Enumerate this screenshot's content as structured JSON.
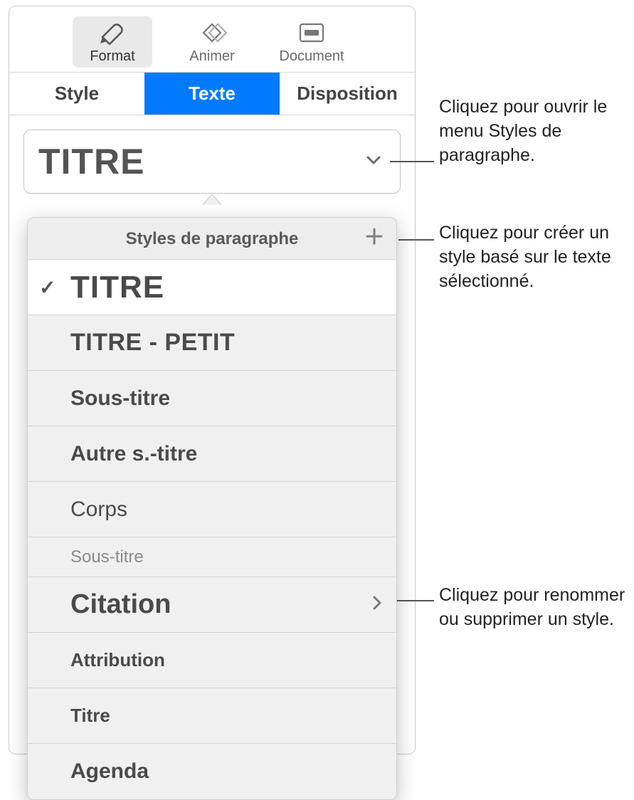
{
  "toolbar": {
    "items": [
      {
        "label": "Format",
        "active": true
      },
      {
        "label": "Animer",
        "active": false
      },
      {
        "label": "Document",
        "active": false
      }
    ]
  },
  "subtabs": {
    "items": [
      {
        "label": "Style",
        "active": false
      },
      {
        "label": "Texte",
        "active": true
      },
      {
        "label": "Disposition",
        "active": false
      }
    ]
  },
  "style_button": {
    "current": "TITRE"
  },
  "popover": {
    "title": "Styles de paragraphe",
    "items": [
      {
        "label": "TITRE",
        "class": "s-titre",
        "checked": true,
        "arrow": false
      },
      {
        "label": "TITRE - PETIT",
        "class": "s-titrep",
        "checked": false,
        "arrow": false
      },
      {
        "label": "Sous-titre",
        "class": "s-sous",
        "checked": false,
        "arrow": false
      },
      {
        "label": "Autre s.-titre",
        "class": "s-autre",
        "checked": false,
        "arrow": false
      },
      {
        "label": "Corps",
        "class": "s-corps",
        "checked": false,
        "arrow": false
      },
      {
        "label": "Sous-titre",
        "class": "s-sous2",
        "checked": false,
        "arrow": false
      },
      {
        "label": "Citation",
        "class": "s-citation",
        "checked": false,
        "arrow": true
      },
      {
        "label": "Attribution",
        "class": "s-attr",
        "checked": false,
        "arrow": false
      },
      {
        "label": "Titre",
        "class": "s-titre2",
        "checked": false,
        "arrow": false
      },
      {
        "label": "Agenda",
        "class": "s-agenda",
        "checked": false,
        "arrow": false
      }
    ]
  },
  "callouts": {
    "open_menu": "Cliquez pour ouvrir le menu Styles de paragraphe.",
    "create_style": "Cliquez pour créer un style basé sur le texte sélectionné.",
    "rename_delete": "Cliquez pour renommer ou supprimer un style."
  }
}
